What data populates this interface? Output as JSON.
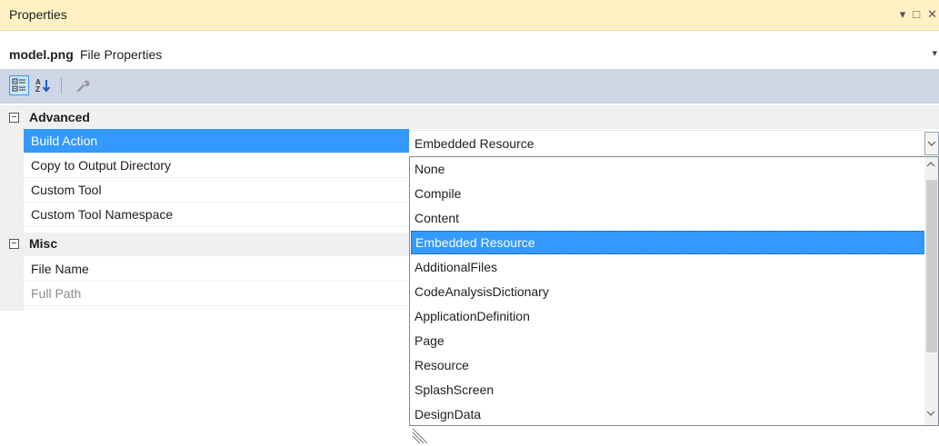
{
  "window": {
    "title": "Properties",
    "controls": {
      "dropdown_icon": "▾",
      "maximize_icon": "□",
      "close_icon": "✕"
    }
  },
  "header": {
    "file_name": "model.png",
    "description": "File Properties",
    "arrow": "▾"
  },
  "toolbar": {
    "buttons": [
      {
        "name": "categorized-icon",
        "active": true
      },
      {
        "name": "alphabetical-icon",
        "active": false
      },
      {
        "name": "property-pages-icon",
        "active": false,
        "disabled": true
      }
    ]
  },
  "grid": {
    "categories": [
      {
        "label": "Advanced",
        "toggle": "⊟",
        "rows": [
          {
            "name": "Build Action",
            "value": "Embedded Resource",
            "selected": true
          },
          {
            "name": "Copy to Output Directory",
            "value": ""
          },
          {
            "name": "Custom Tool",
            "value": ""
          },
          {
            "name": "Custom Tool Namespace",
            "value": ""
          }
        ]
      },
      {
        "label": "Misc",
        "toggle": "⊟",
        "rows": [
          {
            "name": "File Name",
            "value": ""
          },
          {
            "name": "Full Path",
            "value": "",
            "dim": true
          }
        ]
      }
    ]
  },
  "dropdown": {
    "selected": "Embedded Resource",
    "options": [
      "None",
      "Compile",
      "Content",
      "Embedded Resource",
      "AdditionalFiles",
      "CodeAnalysisDictionary",
      "ApplicationDefinition",
      "Page",
      "Resource",
      "SplashScreen",
      "DesignData"
    ]
  },
  "colors": {
    "title_bar": "#fff1c4",
    "toolbar": "#cfd6e5",
    "selection": "#3399ff",
    "category_bg": "#f0f0f0"
  }
}
